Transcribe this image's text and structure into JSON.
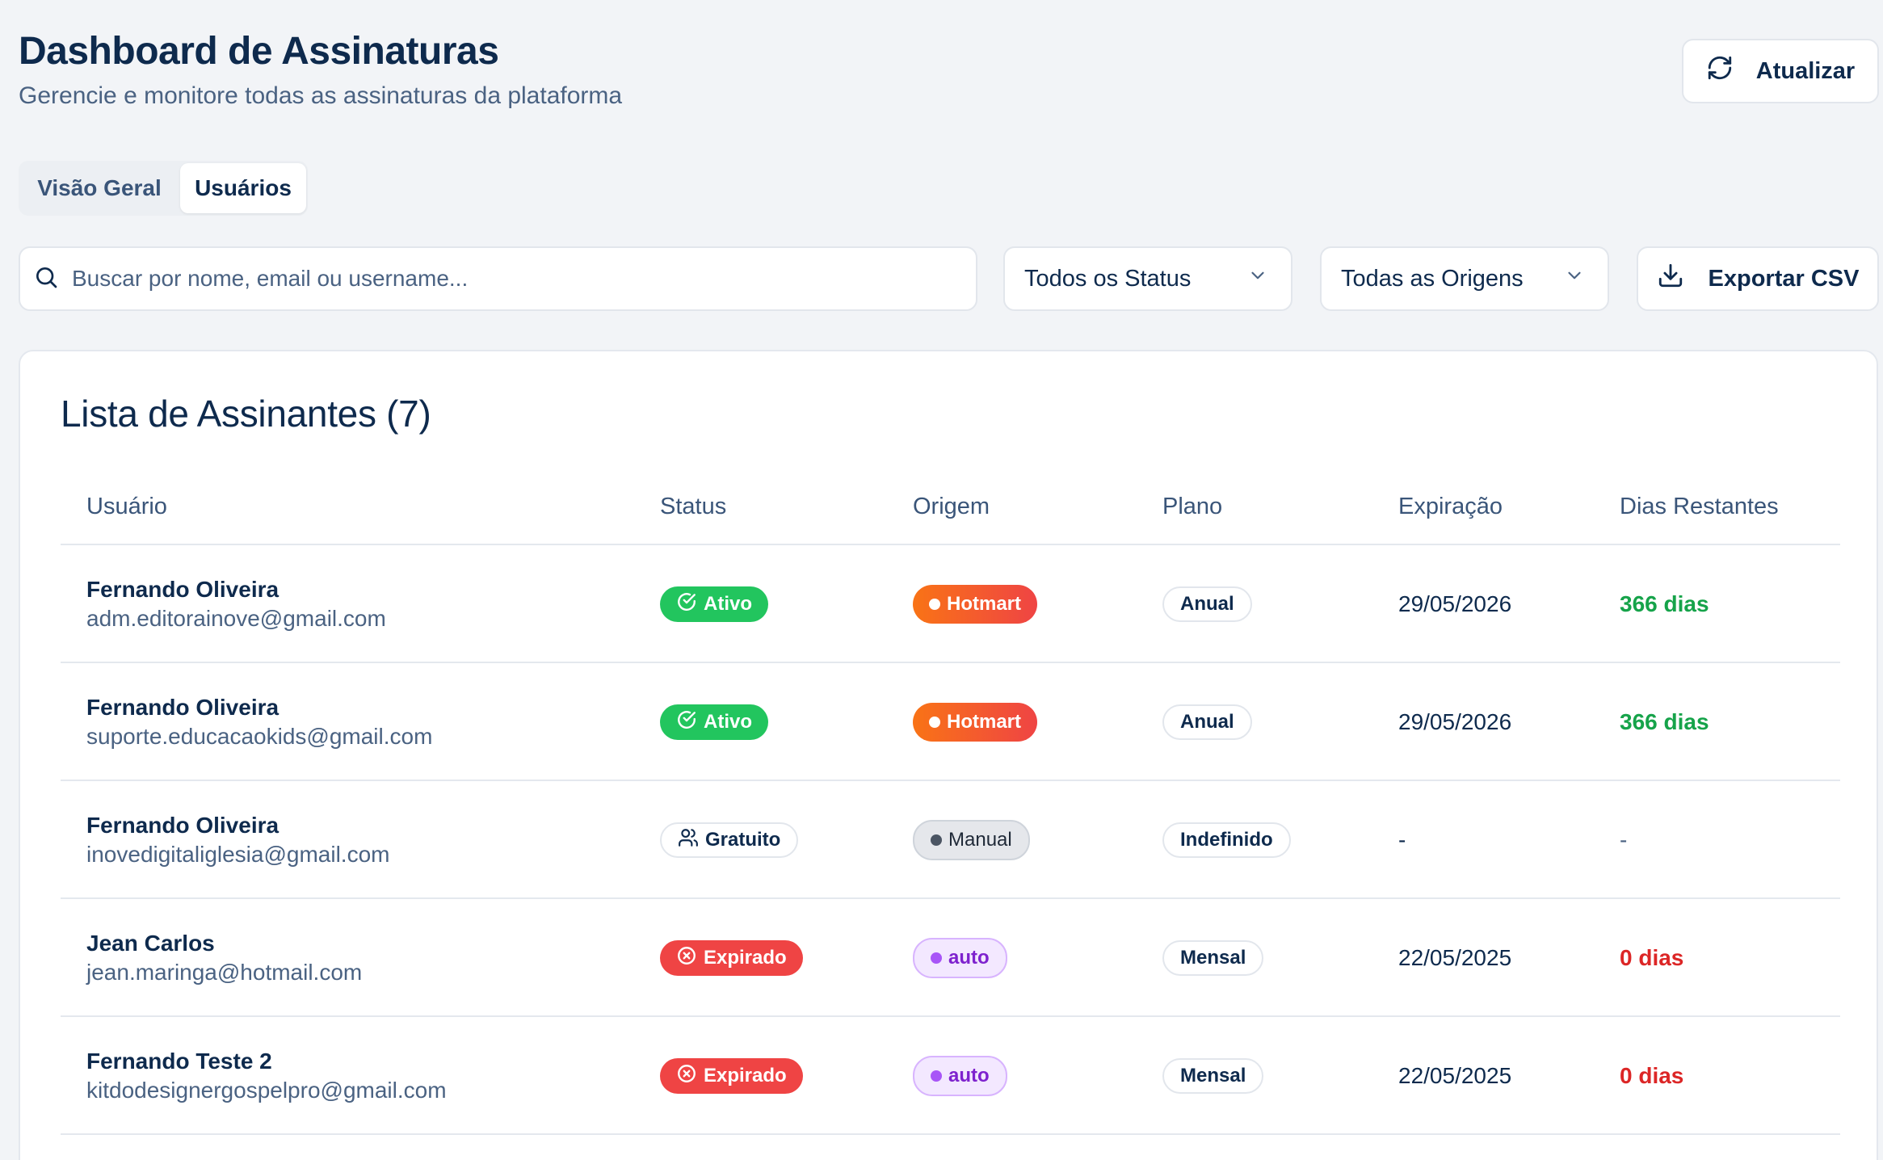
{
  "header": {
    "title": "Dashboard de Assinaturas",
    "subtitle": "Gerencie e monitore todas as assinaturas da plataforma",
    "refresh_label": "Atualizar"
  },
  "tabs": [
    {
      "label": "Visão Geral",
      "active": false
    },
    {
      "label": "Usuários",
      "active": true
    }
  ],
  "filters": {
    "search_placeholder": "Buscar por nome, email ou username...",
    "search_value": "",
    "status_select": "Todos os Status",
    "origin_select": "Todas as Origens",
    "export_label": "Exportar CSV"
  },
  "list": {
    "title": "Lista de Assinantes (7)",
    "columns": [
      "Usuário",
      "Status",
      "Origem",
      "Plano",
      "Expiração",
      "Dias Restantes"
    ],
    "rows": [
      {
        "name": "Fernando Oliveira",
        "email": "adm.editorainove@gmail.com",
        "status": "Ativo",
        "origin": "Hotmart",
        "plan": "Anual",
        "expiration": "29/05/2026",
        "days": "366 dias"
      },
      {
        "name": "Fernando Oliveira",
        "email": "suporte.educacaokids@gmail.com",
        "status": "Ativo",
        "origin": "Hotmart",
        "plan": "Anual",
        "expiration": "29/05/2026",
        "days": "366 dias"
      },
      {
        "name": "Fernando Oliveira",
        "email": "inovedigitaliglesia@gmail.com",
        "status": "Gratuito",
        "origin": "Manual",
        "plan": "Indefinido",
        "expiration": "-",
        "days": "-"
      },
      {
        "name": "Jean Carlos",
        "email": "jean.maringa@hotmail.com",
        "status": "Expirado",
        "origin": "auto",
        "plan": "Mensal",
        "expiration": "22/05/2025",
        "days": "0 dias"
      },
      {
        "name": "Fernando Teste 2",
        "email": "kitdodesignergospelpro@gmail.com",
        "status": "Expirado",
        "origin": "auto",
        "plan": "Mensal",
        "expiration": "22/05/2025",
        "days": "0 dias"
      }
    ]
  },
  "colors": {
    "active": "#22c55e",
    "expired": "#ef4444",
    "hotmart_from": "#f97316",
    "hotmart_to": "#ef4444",
    "auto": "#a855f7",
    "days_positive": "#16a34a",
    "days_zero": "#dc2626"
  },
  "icons": {
    "refresh": "refresh-icon",
    "search": "search-icon",
    "chevron": "chevron-down-icon",
    "download": "download-icon",
    "check": "check-circle-icon",
    "x": "x-circle-icon",
    "users": "users-icon"
  }
}
